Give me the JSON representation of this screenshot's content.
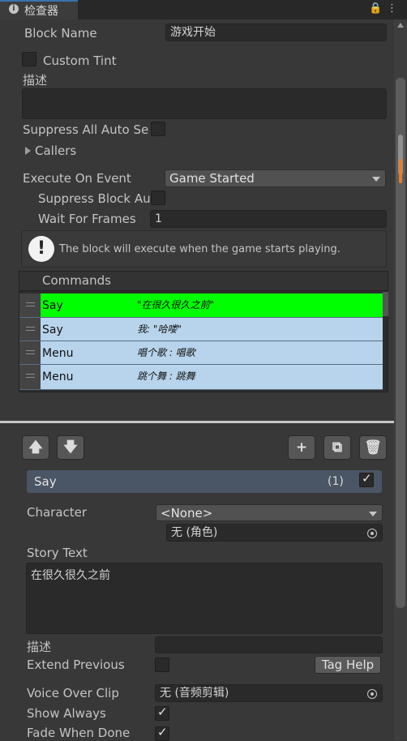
{
  "tab": {
    "title": "检查器",
    "info_glyph": "i"
  },
  "toolbar": {
    "lock_glyph": "🔒",
    "menu_glyph": "⋮"
  },
  "block": {
    "block_name_label": "Block Name",
    "block_name_value": "游戏开始",
    "custom_tint_label": "Custom Tint",
    "custom_tint_checked": false,
    "description_label": "描述",
    "description_value": "",
    "suppress_label": "Suppress All Auto Se",
    "suppress_checked": false,
    "callers_label": "Callers"
  },
  "event": {
    "execute_label": "Execute On Event",
    "execute_value": "Game Started",
    "suppress_block_label": "Suppress Block Au",
    "suppress_block_checked": false,
    "wait_label": "Wait For Frames",
    "wait_value": "1",
    "info_glyph": "!",
    "info_text": "The block will execute when the game starts playing."
  },
  "commands": {
    "title": "Commands",
    "rows": [
      {
        "name": "Say",
        "summary": "\"在很久很久之前\"",
        "selected": true
      },
      {
        "name": "Say",
        "summary": "我: \"哈喽\"",
        "selected": false
      },
      {
        "name": "Menu",
        "summary": "唱个歌 : 唱歌",
        "selected": false
      },
      {
        "name": "Menu",
        "summary": "跳个舞 : 跳舞",
        "selected": false
      }
    ],
    "selected_color": "#00ff00",
    "row_color": "#b8d4ec"
  },
  "command_toolbar": {
    "up_glyph": "🡅",
    "down_glyph": "🡇",
    "add_glyph": "+",
    "duplicate_glyph": "⧉",
    "delete_glyph": "🗑"
  },
  "say": {
    "title": "Say",
    "count": "(1)",
    "enabled": true,
    "character_label": "Character",
    "character_value": "<None>",
    "portrait_value": "无 (角色)",
    "story_label": "Story Text",
    "story_value": "在很久很久之前",
    "description_label": "描述",
    "description_value": "",
    "extend_label": "Extend Previous",
    "extend_checked": false,
    "tag_help_label": "Tag Help",
    "voice_label": "Voice Over Clip",
    "voice_value": "无 (音频剪辑)",
    "show_always_label": "Show Always",
    "show_always_checked": true,
    "fade_label": "Fade When Done",
    "fade_checked": true
  }
}
